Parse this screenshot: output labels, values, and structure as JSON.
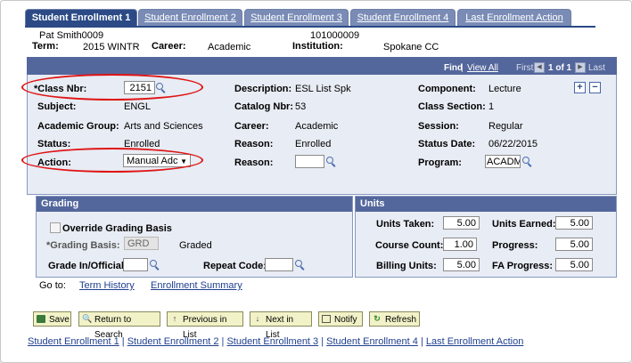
{
  "tabs": [
    {
      "label": "Student Enrollment 1",
      "active": true
    },
    {
      "label": "Student Enrollment 2",
      "active": false
    },
    {
      "label": "Student Enrollment 3",
      "active": false
    },
    {
      "label": "Student Enrollment 4",
      "active": false
    },
    {
      "label": "Last Enrollment Action",
      "active": false
    }
  ],
  "header": {
    "student_name": "Pat Smith0009",
    "student_id": "101000009",
    "term_label": "Term:",
    "term_value": "2015 WINTR",
    "career_label": "Career:",
    "career_value": "Academic",
    "institution_label": "Institution:",
    "institution_value": "Spokane CC"
  },
  "nav": {
    "find": "Find",
    "view_all": "View All",
    "first": "First",
    "count": "1 of 1",
    "last": "Last",
    "add": "+",
    "remove": "−"
  },
  "class": {
    "class_nbr_label": "*Class Nbr:",
    "class_nbr_value": "2151",
    "description_label": "Description:",
    "description_value": "ESL List Spk",
    "component_label": "Component:",
    "component_value": "Lecture",
    "subject_label": "Subject:",
    "subject_value": "ENGL",
    "catalog_label": "Catalog Nbr:",
    "catalog_value": "53",
    "section_label": "Class Section:",
    "section_value": "1",
    "acad_group_label": "Academic Group:",
    "acad_group_value": "Arts and Sciences",
    "career_label": "Career:",
    "career_value": "Academic",
    "session_label": "Session:",
    "session_value": "Regular",
    "status_label": "Status:",
    "status_value": "Enrolled",
    "reason_label": "Reason:",
    "reason_value": "Enrolled",
    "status_date_label": "Status Date:",
    "status_date_value": "06/22/2015",
    "action_label": "Action:",
    "action_value": "Manual Adc",
    "reason2_label": "Reason:",
    "reason2_value": "",
    "program_label": "Program:",
    "program_value": "ACADM"
  },
  "grading": {
    "title": "Grading",
    "override_label": "Override Grading Basis",
    "basis_label": "*Grading Basis:",
    "basis_value": "GRD",
    "basis_desc": "Graded",
    "grade_label": "Grade In/Official:",
    "grade_value": "",
    "repeat_label": "Repeat Code:",
    "repeat_value": ""
  },
  "units": {
    "title": "Units",
    "taken_label": "Units Taken:",
    "taken_value": "5.00",
    "earned_label": "Units Earned:",
    "earned_value": "5.00",
    "course_count_label": "Course Count:",
    "course_count_value": "1.00",
    "progress_label": "Progress:",
    "progress_value": "5.00",
    "billing_label": "Billing Units:",
    "billing_value": "5.00",
    "fa_label": "FA Progress:",
    "fa_value": "5.00"
  },
  "goto": {
    "label": "Go to:",
    "term_history": "Term History",
    "enrollment_summary": "Enrollment Summary"
  },
  "toolbar": {
    "save": "Save",
    "return": "Return to Search",
    "previous": "Previous in List",
    "next": "Next in List",
    "notify": "Notify",
    "refresh": "Refresh"
  },
  "footer_links": [
    "Student Enrollment 1",
    "Student Enrollment 2",
    "Student Enrollment 3",
    "Student Enrollment 4",
    "Last Enrollment Action"
  ],
  "footer_sep": " | ",
  "colors": {
    "tab_active": "#2b4a86",
    "band": "#54679c",
    "panel_bg": "#e8ecf4",
    "highlight": "#e01414"
  }
}
